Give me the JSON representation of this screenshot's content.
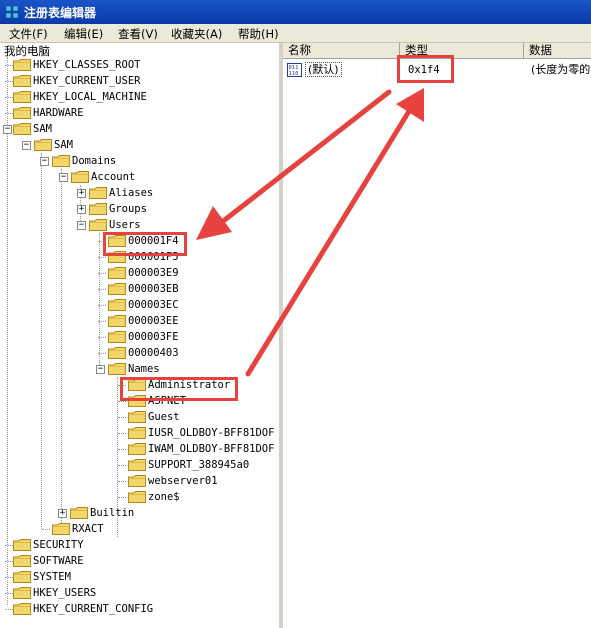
{
  "window": {
    "title": "注册表编辑器"
  },
  "menu": [
    "文件(F)",
    "编辑(E)",
    "查看(V)",
    "收藏夹(A)",
    "帮助(H)"
  ],
  "tree": {
    "root": "我的电脑",
    "items": [
      "HKEY_CLASSES_ROOT",
      "HKEY_CURRENT_USER",
      "HKEY_LOCAL_MACHINE",
      "HARDWARE",
      "SAM",
      "SAM",
      "Domains",
      "Account",
      "Aliases",
      "Groups",
      "Users",
      "000001F4",
      "000001F5",
      "000003E9",
      "000003EB",
      "000003EC",
      "000003EE",
      "000003FE",
      "00000403",
      "Names",
      "Administrator",
      "ASPNET",
      "Guest",
      "IUSR_OLDBOY-BFF81DOF",
      "IWAM_OLDBOY-BFF81DOF",
      "SUPPORT_388945a0",
      "webserver01",
      "zone$",
      "Builtin",
      "RXACT",
      "SECURITY",
      "SOFTWARE",
      "SYSTEM",
      "HKEY_USERS",
      "HKEY_CURRENT_CONFIG"
    ]
  },
  "list": {
    "columns": [
      "名称",
      "类型",
      "数据"
    ],
    "row": {
      "name": "(默认)",
      "type": "0x1f4",
      "data": "(长度为零的"
    }
  },
  "colors": {
    "highlight": "#e8423e",
    "titlebar": "#0a3aa8",
    "folder": "#f2d56b"
  }
}
